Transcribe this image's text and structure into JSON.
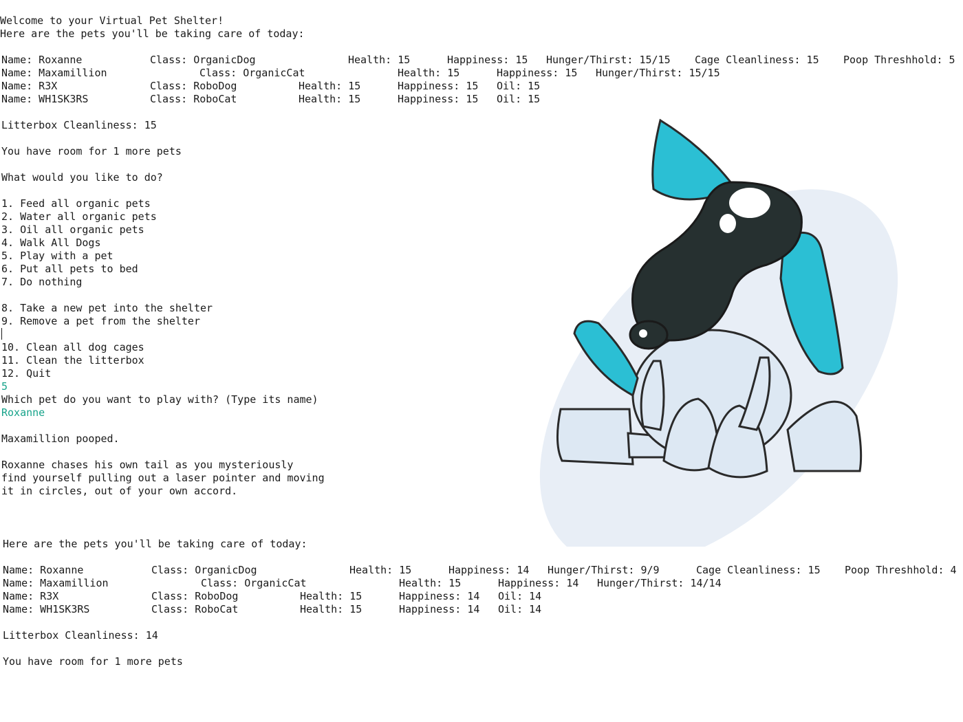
{
  "intro": {
    "welcome": "Welcome to your Virtual Pet Shelter!",
    "pets_heading": "Here are the pets you'll be taking care of today:"
  },
  "roster_before": {
    "pets": [
      {
        "name": "Name: Roxanne",
        "class": "Class: OrganicDog",
        "health": "Health: 15",
        "happiness": "Happiness: 15",
        "need": "Hunger/Thirst: 15/15",
        "cage": "Cage Cleanliness: 15",
        "poop": "Poop Threshhold: 5"
      },
      {
        "name": "Name: Maxamillion",
        "class": "Class: OrganicCat",
        "health": "Health: 15",
        "happiness": "Happiness: 15",
        "need": "Hunger/Thirst: 15/15"
      },
      {
        "name": "Name: R3X",
        "class": "Class: RoboDog",
        "health": "Health: 15",
        "happiness": "Happiness: 15",
        "need": "Oil: 15"
      },
      {
        "name": "Name: WH1SK3RS",
        "class": "Class: RoboCat",
        "health": "Health: 15",
        "happiness": "Happiness: 15",
        "need": "Oil: 15"
      }
    ],
    "litterbox": "Litterbox Cleanliness: 15",
    "room": "You have room for 1 more pets"
  },
  "menu": {
    "prompt": "What would you like to do?",
    "options": [
      "1. Feed all organic pets",
      "2. Water all organic pets",
      "3. Oil all organic pets",
      "4. Walk All Dogs",
      "5. Play with a pet",
      "6. Put all pets to bed",
      "7. Do nothing",
      "8. Take a new pet into the shelter",
      "9. Remove a pet from the shelter",
      "10. Clean all dog cages",
      "11. Clean the litterbox",
      "12. Quit"
    ]
  },
  "interaction": {
    "choice_input": "5",
    "pet_prompt": "Which pet do you want to play with? (Type its name)",
    "pet_input": "Roxanne",
    "event": "Maxamillion pooped.",
    "play_result": [
      "Roxanne chases his own tail as you mysteriously",
      "find yourself pulling out a laser pointer and moving",
      "it in circles, out of your own accord."
    ]
  },
  "roster_after": {
    "heading": "Here are the pets you'll be taking care of today:",
    "pets": [
      {
        "name": "Name: Roxanne",
        "class": "Class: OrganicDog",
        "health": "Health: 15",
        "happiness": "Happiness: 14",
        "need": "Hunger/Thirst: 9/9",
        "cage": "Cage Cleanliness: 15",
        "poop": "Poop Threshhold: 4"
      },
      {
        "name": "Name: Maxamillion",
        "class": "Class: OrganicCat",
        "health": "Health: 15",
        "happiness": "Happiness: 14",
        "need": "Hunger/Thirst: 14/14"
      },
      {
        "name": "Name: R3X",
        "class": "Class: RoboDog",
        "health": "Health: 15",
        "happiness": "Happiness: 14",
        "need": "Oil: 14"
      },
      {
        "name": "Name: WH1SK3RS",
        "class": "Class: RoboCat",
        "health": "Health: 15",
        "happiness": "Happiness: 14",
        "need": "Oil: 14"
      }
    ],
    "litterbox": "Litterbox Cleanliness: 14",
    "room": "You have room for 1 more pets"
  },
  "colors": {
    "text": "#1a1a1a",
    "input_echo": "#16a38a",
    "mascot_accent": "#2bbfd4",
    "mascot_dark": "#263030",
    "mascot_body": "#dde8f3",
    "backdrop": "#e8eef6"
  },
  "icons": {
    "watermark": "robot-dog-mascot"
  }
}
